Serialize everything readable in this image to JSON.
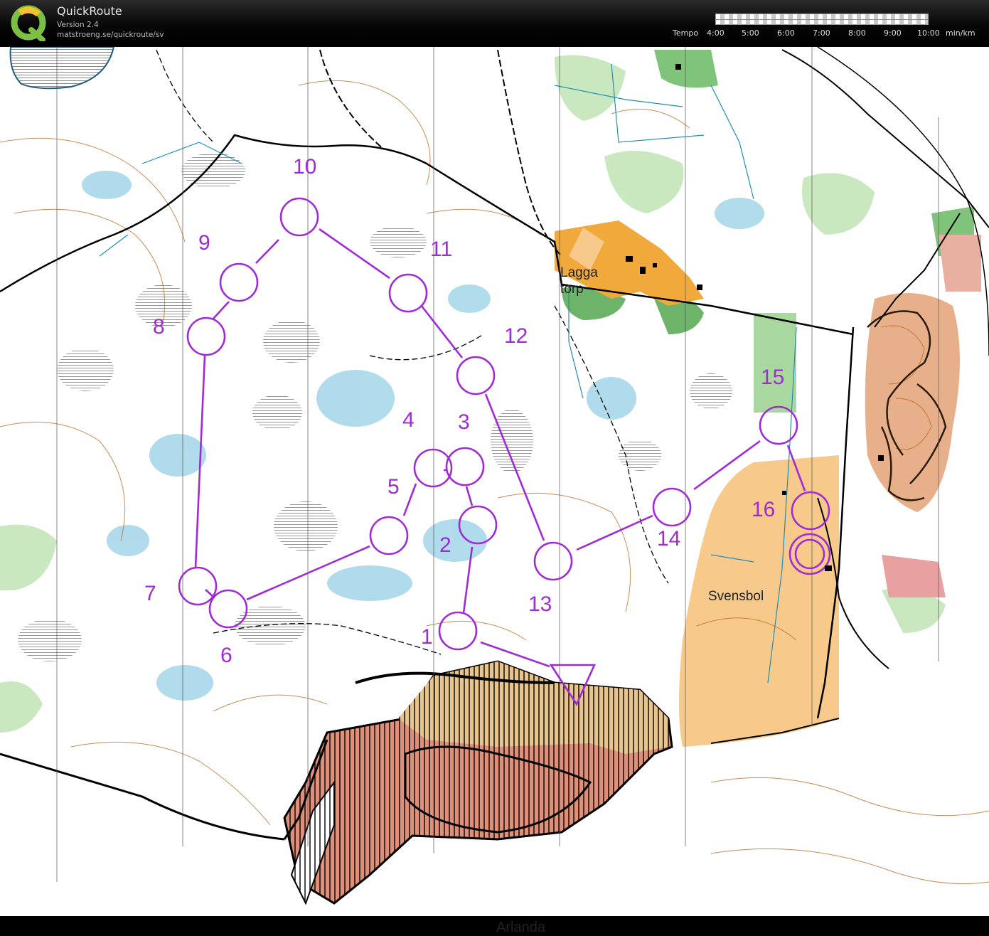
{
  "header": {
    "app_title": "QuickRoute",
    "version": "Version 2.4",
    "url": "matstroeng.se/quickroute/sv",
    "tempo_label": "Tempo",
    "tempo_ticks": [
      "4:00",
      "5:00",
      "6:00",
      "7:00",
      "8:00",
      "9:00",
      "10:00"
    ],
    "tempo_unit": "min/km"
  },
  "map": {
    "place_names": {
      "lagga_line1": "Lagga",
      "lagga_line2": "torp",
      "svensbol": "Svensbol",
      "arlanda": "Arlanda"
    },
    "course_color": "#a02bd6",
    "start_symbol": "start-triangle-icon",
    "finish_symbol": "finish-double-circle-icon",
    "controls": [
      {
        "label": "1"
      },
      {
        "label": "2"
      },
      {
        "label": "3"
      },
      {
        "label": "4"
      },
      {
        "label": "5"
      },
      {
        "label": "6"
      },
      {
        "label": "7"
      },
      {
        "label": "8"
      },
      {
        "label": "9"
      },
      {
        "label": "10"
      },
      {
        "label": "11"
      },
      {
        "label": "12"
      },
      {
        "label": "13"
      },
      {
        "label": "14"
      },
      {
        "label": "15"
      },
      {
        "label": "16"
      }
    ],
    "colors": {
      "open_land": "#f7c98a",
      "settlement": "#f0a93a",
      "forest_green": "#7fc47a",
      "marsh_blue": "#3aa7c9",
      "out_of_bounds": "#e0907a",
      "contour_brown": "#b8651e",
      "map_white": "#ffffff"
    }
  }
}
